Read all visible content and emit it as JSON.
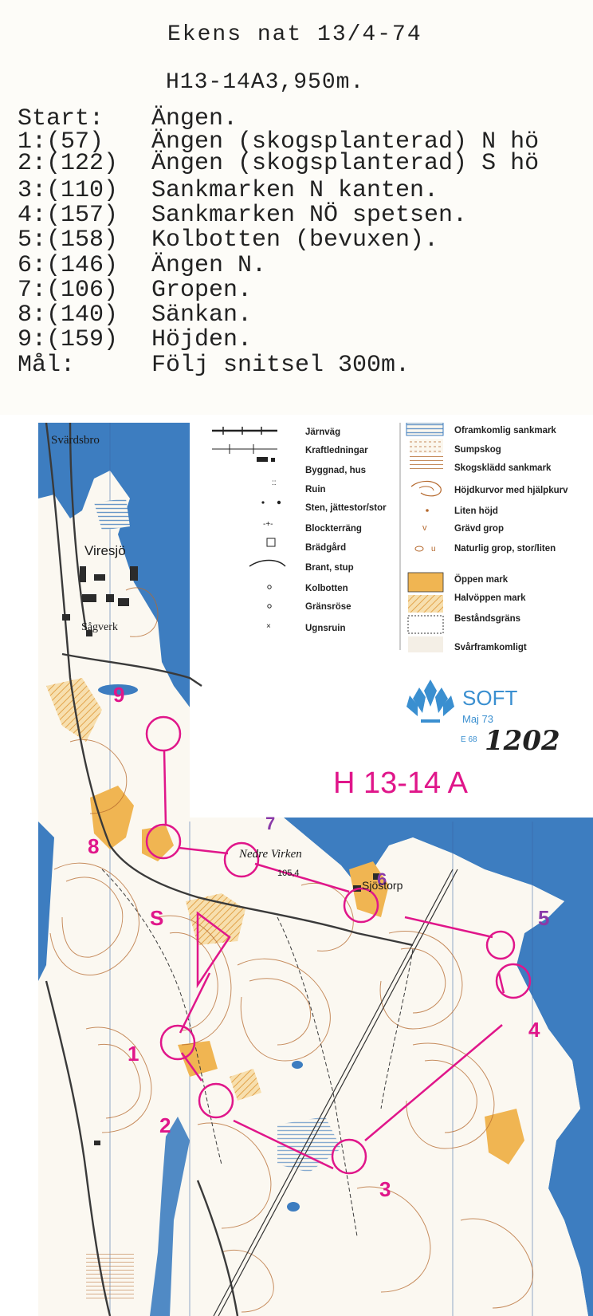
{
  "header": {
    "line1": "Ekens nat 13/4-74",
    "line2": "H13-14A3,950m."
  },
  "controls": [
    {
      "code": "Start:",
      "desc": "Ängen."
    },
    {
      "code": "1:(57)",
      "desc": "Ängen (skogsplanterad) N hö"
    },
    {
      "code": "2:(122)",
      "desc": "Ängen (skogsplanterad) S hö"
    },
    {
      "code": "3:(110)",
      "desc": "Sankmarken N kanten."
    },
    {
      "code": "4:(157)",
      "desc": "Sankmarken NÖ spetsen."
    },
    {
      "code": "5:(158)",
      "desc": "Kolbotten (bevuxen)."
    },
    {
      "code": "6:(146)",
      "desc": "Ängen N."
    },
    {
      "code": "7:(106)",
      "desc": "Gropen."
    },
    {
      "code": "8:(140)",
      "desc": "Sänkan."
    },
    {
      "code": "9:(159)",
      "desc": "Höjden."
    },
    {
      "code": "Mål:",
      "desc": "Följ snitsel 300m."
    }
  ],
  "legend": {
    "left": [
      "Järnväg",
      "Kraftledningar",
      "Byggnad, hus",
      "Ruin",
      "Sten, jättestor/stor",
      "Blockterräng",
      "Brädgård",
      "Brant, stup",
      "Kolbotten",
      "Gränsröse",
      "Ugnsruin"
    ],
    "right": [
      "Oframkomlig sankmark",
      "Sumpskog",
      "Skogsklädd sankmark",
      "Höjdkurvor med hjälpkurv",
      "Liten höjd",
      "Grävd grop",
      "Naturlig grop, stor/liten",
      "Öppen mark",
      "Halvöppen mark",
      "Beståndsgräns",
      "Svårframkomligt"
    ]
  },
  "brand": {
    "name": "SOFT",
    "date": "Maj 73",
    "code": "E 68",
    "handwritten_number": "1202",
    "course": "H 13-14 A"
  },
  "place_names": {
    "svardsbro": "Svärdsbro",
    "viresjo": "Viresjö",
    "sagverk": "Sågverk",
    "nedre_virken": "Nedre Virken",
    "height": "105,4",
    "sjostorp": "Sjöstorp"
  },
  "course_labels": {
    "start": "S",
    "c1": "1",
    "c2": "2",
    "c3": "3",
    "c4": "4",
    "c5": "5",
    "c6": "6",
    "c7": "7",
    "c8": "8",
    "c9": "9"
  },
  "colors": {
    "water": "#3d7dc0",
    "course": "#e0168a",
    "open_land": "#f0b552",
    "contour": "#b5692e",
    "soft_blue": "#3a8fd0"
  }
}
